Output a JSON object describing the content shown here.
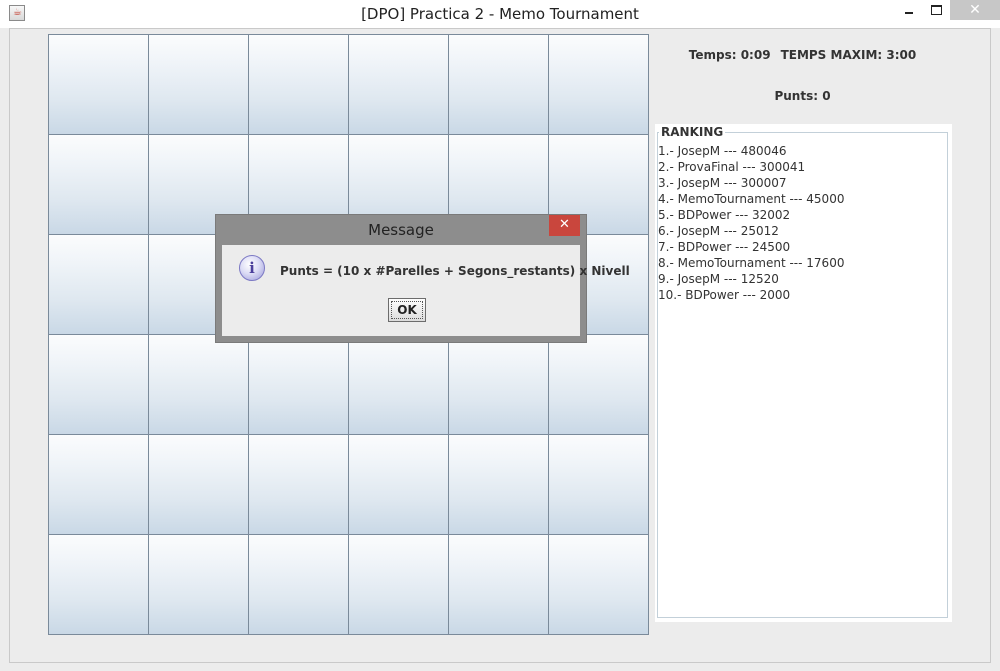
{
  "window": {
    "title": "[DPO] Practica 2 - Memo Tournament",
    "icon": "java-app-icon",
    "controls": {
      "minimize": "minimize-icon",
      "maximize": "maximize-icon",
      "close": "✕"
    }
  },
  "board": {
    "rows": 6,
    "columns": 6,
    "card_state": "face-down"
  },
  "status": {
    "time_text": "Temps: 0:09",
    "max_time_text": "TEMPS MAXIM: 3:00",
    "points_text": "Punts: 0"
  },
  "ranking": {
    "title": "RANKING",
    "entries": [
      "1.- JosepM --- 480046",
      "2.- ProvaFinal --- 300041",
      "3.- JosepM --- 300007",
      "4.- MemoTournament --- 45000",
      "5.- BDPower --- 32002",
      "6.- JosepM --- 25012",
      "7.- BDPower --- 24500",
      "8.- MemoTournament --- 17600",
      "9.- JosepM --- 12520",
      "10.- BDPower --- 2000"
    ]
  },
  "dialog": {
    "title": "Message",
    "close_label": "✕",
    "icon": "info-icon",
    "icon_glyph": "i",
    "message": "Punts = (10 x #Parelles + Segons_restants) x Nivell",
    "ok_label": "OK"
  },
  "colors": {
    "dialog_close": "#c9463d",
    "card_top": "#fbfcfd",
    "card_bottom": "#c9d8e6"
  }
}
